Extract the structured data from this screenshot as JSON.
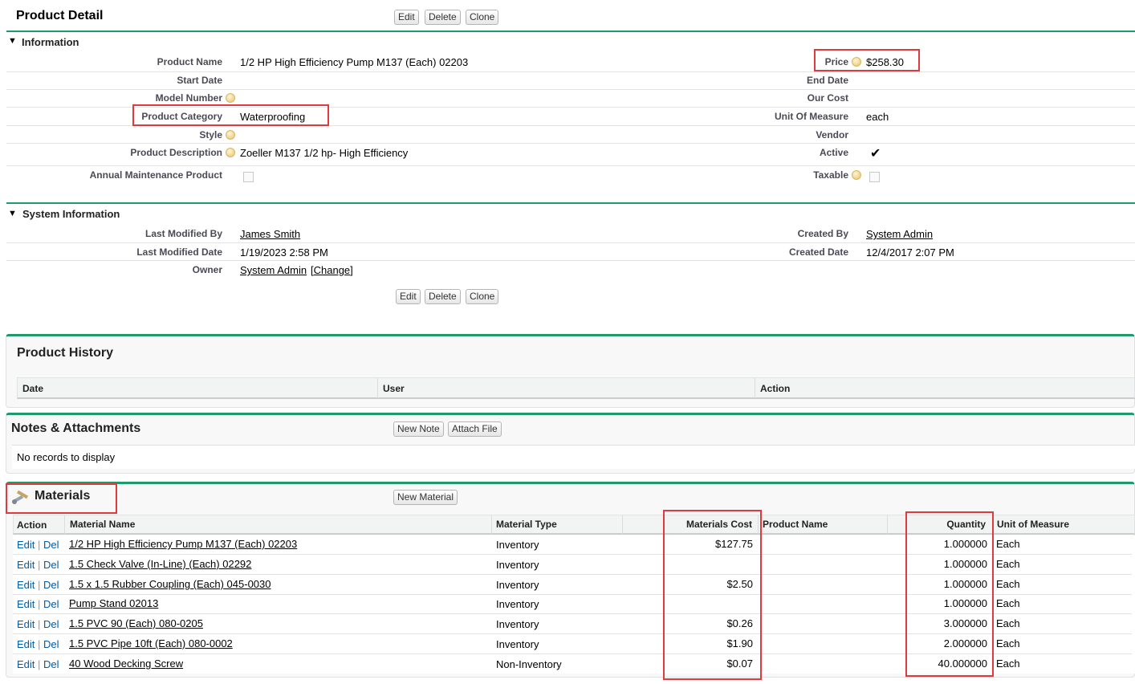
{
  "page_title": "Product Detail",
  "buttons": {
    "edit": "Edit",
    "delete": "Delete",
    "clone": "Clone"
  },
  "information": {
    "title": "Information",
    "left": [
      {
        "label": "Product Name",
        "value": "1/2 HP High Efficiency Pump M137 (Each) 02203"
      },
      {
        "label": "Start Date",
        "value": ""
      },
      {
        "label": "Model Number",
        "value": ""
      },
      {
        "label": "Product Category",
        "value": "Waterproofing"
      },
      {
        "label": "Style",
        "value": ""
      },
      {
        "label": "Product Description",
        "value": "Zoeller M137 1/2 hp- High Efficiency"
      },
      {
        "label": "Annual Maintenance Product",
        "value": ""
      }
    ],
    "right": [
      {
        "label": "Price",
        "value": "$258.30"
      },
      {
        "label": "End Date",
        "value": ""
      },
      {
        "label": "Our Cost",
        "value": ""
      },
      {
        "label": "Unit Of Measure",
        "value": "each"
      },
      {
        "label": "Vendor",
        "value": ""
      },
      {
        "label": "Active",
        "value": "✔"
      },
      {
        "label": "Taxable",
        "value": ""
      }
    ]
  },
  "system_information": {
    "title": "System Information",
    "last_modified_by_label": "Last Modified By",
    "last_modified_by": "James Smith",
    "last_modified_date_label": "Last Modified Date",
    "last_modified_date": "1/19/2023 2:58 PM",
    "owner_label": "Owner",
    "owner": "System Admin",
    "change": "[Change]",
    "created_by_label": "Created By",
    "created_by": "System Admin",
    "created_date_label": "Created Date",
    "created_date": "12/4/2017 2:07 PM"
  },
  "product_history": {
    "title": "Product History",
    "columns": [
      "Date",
      "User",
      "Action"
    ]
  },
  "notes": {
    "title": "Notes & Attachments",
    "new_note": "New Note",
    "attach_file": "Attach File",
    "empty": "No records to display"
  },
  "materials": {
    "title": "Materials",
    "new_material": "New Material",
    "columns": {
      "action": "Action",
      "material_name": "Material Name",
      "material_type": "Material Type",
      "materials_cost": "Materials Cost",
      "product_name": "Product Name",
      "quantity": "Quantity",
      "unit": "Unit of Measure"
    },
    "edit": "Edit",
    "sep": "|",
    "del": "Del",
    "rows": [
      {
        "name": "1/2 HP High Efficiency Pump M137 (Each) 02203",
        "type": "Inventory",
        "cost": "$127.75",
        "product": "",
        "qty": "1.000000",
        "unit": "Each"
      },
      {
        "name": "1.5 Check Valve (In-Line) (Each) 02292",
        "type": "Inventory",
        "cost": "",
        "product": "",
        "qty": "1.000000",
        "unit": "Each"
      },
      {
        "name": "1.5 x 1.5 Rubber Coupling (Each) 045-0030",
        "type": "Inventory",
        "cost": "$2.50",
        "product": "",
        "qty": "1.000000",
        "unit": "Each"
      },
      {
        "name": "Pump Stand 02013",
        "type": "Inventory",
        "cost": "",
        "product": "",
        "qty": "1.000000",
        "unit": "Each"
      },
      {
        "name": "1.5 PVC 90 (Each) 080-0205",
        "type": "Inventory",
        "cost": "$0.26",
        "product": "",
        "qty": "3.000000",
        "unit": "Each"
      },
      {
        "name": "1.5 PVC Pipe 10ft (Each) 080-0002",
        "type": "Inventory",
        "cost": "$1.90",
        "product": "",
        "qty": "2.000000",
        "unit": "Each"
      },
      {
        "name": "40 Wood Decking Screw",
        "type": "Non-Inventory",
        "cost": "$0.07",
        "product": "",
        "qty": "40.000000",
        "unit": "Each"
      }
    ]
  },
  "colors": {
    "accent_line": "#1f9a6a",
    "highlight": "#e0393e",
    "link_action": "#015ba7"
  }
}
